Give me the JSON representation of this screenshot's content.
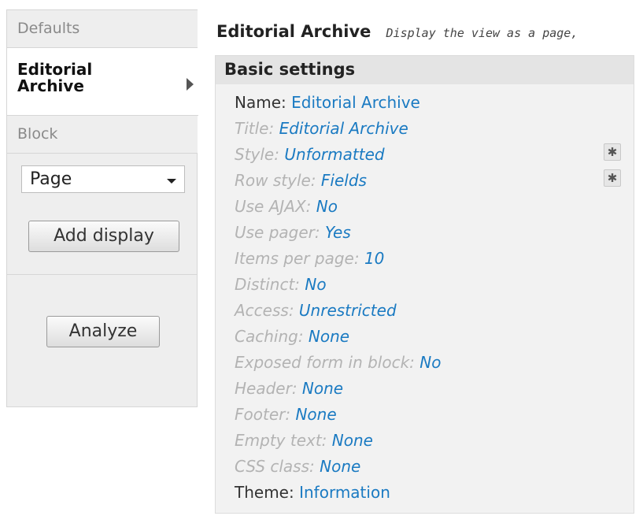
{
  "sidebar": {
    "tabs": [
      {
        "label": "Defaults"
      },
      {
        "label": "Editorial Archive"
      },
      {
        "label": "Block"
      }
    ],
    "display_select_value": "Page",
    "add_display_label": "Add display",
    "analyze_label": "Analyze"
  },
  "header": {
    "title": "Editorial Archive",
    "description": "Display the view as a page,"
  },
  "settings": {
    "title": "Basic settings",
    "rows": [
      {
        "label": "Name:",
        "value": "Editorial Archive"
      },
      {
        "label": "Title:",
        "value": "Editorial Archive"
      },
      {
        "label": "Style:",
        "value": "Unformatted"
      },
      {
        "label": "Row style:",
        "value": "Fields"
      },
      {
        "label": "Use AJAX:",
        "value": "No"
      },
      {
        "label": "Use pager:",
        "value": "Yes"
      },
      {
        "label": "Items per page:",
        "value": "10"
      },
      {
        "label": "Distinct:",
        "value": "No"
      },
      {
        "label": "Access:",
        "value": "Unrestricted"
      },
      {
        "label": "Caching:",
        "value": "None"
      },
      {
        "label": "Exposed form in block:",
        "value": "No"
      },
      {
        "label": "Header:",
        "value": "None"
      },
      {
        "label": "Footer:",
        "value": "None"
      },
      {
        "label": "Empty text:",
        "value": "None"
      },
      {
        "label": "CSS class:",
        "value": "None"
      },
      {
        "label": "Theme:",
        "value": "Information"
      }
    ]
  },
  "icons": {
    "gear": "gear-icon",
    "arrow": "arrow-right-icon",
    "caret": "chevron-down-icon"
  }
}
